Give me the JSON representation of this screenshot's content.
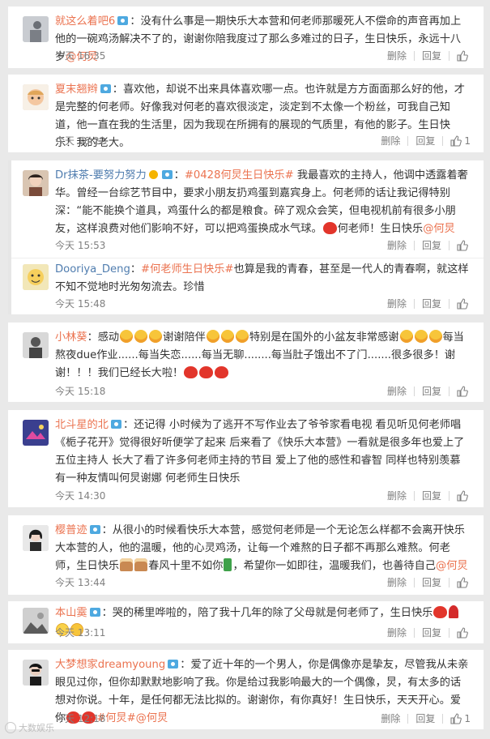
{
  "actions": {
    "delete": "删除",
    "reply": "回复"
  },
  "colors": {
    "username": "#eb7350",
    "link": "#507daf",
    "text": "#333333",
    "meta": "#808080"
  },
  "watermark": "大数娱乐",
  "comments": [
    {
      "user": "就这么着吧6",
      "text": "没有什么事是一期快乐大本营和何老师那暖死人不偿命的声音再加上他的一碗鸡汤解决不了的，谢谢你陪我度过了那么多难过的日子，生日快乐，永远十八岁",
      "mention": "@何炅",
      "time": "今天 16:35",
      "likes": ""
    },
    {
      "user": "夏末翘辫",
      "text": "喜欢他，却说不出来具体喜欢哪一点。也许就是方方面面那么好的他，才是完整的何老师。好像我对何老的喜欢很淡定，淡定到不太像一个粉丝，可我自己知道，他一直在我的生活里，因为我现在所拥有的展现的气质里，有他的影子。生日快乐！我的老大。",
      "time": "今天 16:22",
      "likes": "1"
    },
    {
      "user": "Dr抹茶-要努力努力",
      "tag": "#0428何炅生日快乐#",
      "text": "我最喜欢的主持人，他调中透露着奢华。曾经一台综艺节目中，要求小朋友扔鸡蛋到嘉宾身上。何老师的话让我记得特别深：“能不能换个道具，鸡蛋什么的都是粮食。碎了观众会笑，但电视机前有很多小朋友，这样浪费对他们影响不好，可以把鸡蛋换成水气球。",
      "text2": "何老师！生日快乐",
      "mention": "@何炅",
      "time": "今天 15:53",
      "likes": ""
    },
    {
      "user": "Dooriya_Deng",
      "tag": "#何老师生日快乐#",
      "text": "也算是我的青春，甚至是一代人的青春啊，就这样不知不觉地时光匆匆流去。珍惜",
      "time": "今天 15:48",
      "likes": ""
    },
    {
      "user": "小林葵",
      "text_a": "感动",
      "text_b": "谢谢陪伴",
      "text_c": "特别是在国外的小盆友非常感谢",
      "text_d": "每当熬夜due作业......每当失恋......每当无聊........每当肚子饿出不了门.......很多很多！谢谢！！！我们已经长大啦！",
      "time": "今天 15:18",
      "likes": ""
    },
    {
      "user": "北斗星的北",
      "text": "还记得 小时候为了逃开不写作业去了爷爷家看电视 看见听见何老师唱《栀子花开》觉得很好听便学了起来 后来看了《快乐大本营》一看就是很多年也爱上了五位主持人 长大了看了许多何老师主持的节目 爱上了他的感性和睿智 同样也特别羡慕有一种友情叫何炅谢娜 何老师生日快乐",
      "time": "今天 14:30",
      "likes": ""
    },
    {
      "user": "樱普迹",
      "text": "从很小的时候看快乐大本营，感觉何老师是一个无论怎么样都不会离开快乐大本营的人，他的温暖，他的心灵鸡汤，让每一个难熬的日子都不再那么难熬。何老师，生日快乐",
      "text2": "春风十里不如你",
      "text3": "，希望你一如即往，温暖我们，也善待自己",
      "mention": "@何炅",
      "time": "今天 13:44",
      "likes": ""
    },
    {
      "user": "本山霙",
      "text": "哭的稀里哗啦的，陪了我十几年的除了父母就是何老师了，生日快乐",
      "time": "今天 13:11",
      "likes": ""
    },
    {
      "user": "大梦想家dreamyoung",
      "text": "爱了近十年的一个男人，你是偶像亦是挚友，尽管我从未亲眼见过你，但你却默默地影响了我。你是给过我影响最大的一个偶像，炅，有太多的话想对你说。十年，是任何都无法比拟的。谢谢你，有你真好！生日快乐，天天开心。爱你",
      "tag": "#何炅#",
      "mention": "@何炅",
      "time": "今天 12:18",
      "likes": "1"
    }
  ]
}
